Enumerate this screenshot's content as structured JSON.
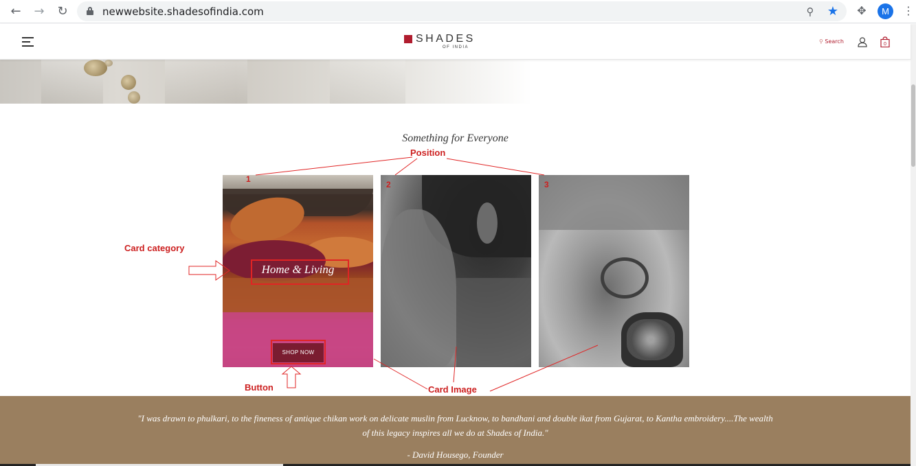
{
  "browser": {
    "url": "newwebsite.shadesofindia.com",
    "back_icon": "arrow-left-icon",
    "forward_icon": "arrow-right-icon",
    "reload_icon": "reload-icon",
    "profile_initial": "M",
    "accent_color": "#1a73e8"
  },
  "header": {
    "logo_main": "SHADES",
    "logo_sub": "OF INDIA",
    "search_label": "Search",
    "cart_count": "0",
    "brand_color": "#b01c2e"
  },
  "section": {
    "title": "Something for Everyone",
    "cards": [
      {
        "category": "Home & Living",
        "button": "SHOP NOW"
      }
    ]
  },
  "annotations": {
    "position": "Position",
    "card_category": "Card category",
    "button": "Button",
    "card_image": "Card Image",
    "positions": [
      "1",
      "2",
      "3"
    ],
    "color": "#cc1f1f"
  },
  "quote": {
    "text": "\"I was drawn to phulkari, to the fineness of antique chikan work on delicate muslin from Lucknow, to bandhani and double ikat from Gujarat, to Kantha embroidery....The wealth of this legacy inspires all we do at Shades of India.\"",
    "author": "- David Housego, Founder",
    "band_color": "#9a7f5f"
  }
}
